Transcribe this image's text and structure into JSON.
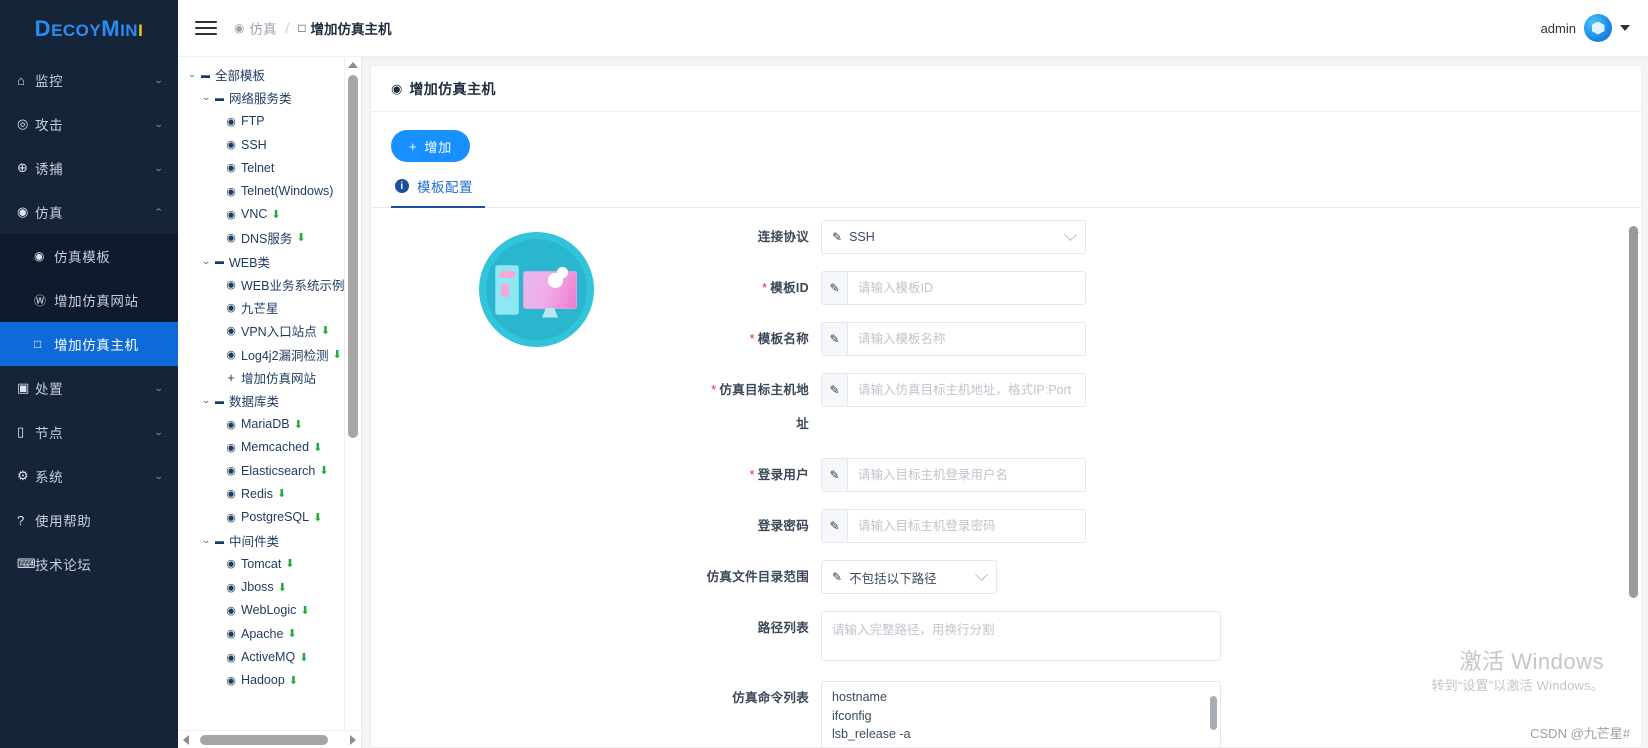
{
  "brand": {
    "name_part1": "D",
    "name_part2": "ECOY",
    "name_part3": "M",
    "name_part4": "IN",
    "name_dot": "I",
    "full": "DecoyMini"
  },
  "sidebar": {
    "items": [
      {
        "icon": "home-icon",
        "glyph": "⌂",
        "label": "监控",
        "arrow": "⌄",
        "expanded": false,
        "active": false
      },
      {
        "icon": "target-icon",
        "glyph": "◎",
        "label": "攻击",
        "arrow": "⌄",
        "expanded": false,
        "active": false
      },
      {
        "icon": "capture-icon",
        "glyph": "⊕",
        "label": "诱捕",
        "arrow": "⌄",
        "expanded": false,
        "active": false
      },
      {
        "icon": "simulation-icon",
        "glyph": "◉",
        "label": "仿真",
        "arrow": "⌃",
        "expanded": true,
        "active": false
      },
      {
        "icon": "disposal-icon",
        "glyph": "▣",
        "label": "处置",
        "arrow": "⌄",
        "expanded": false,
        "active": false
      },
      {
        "icon": "node-icon",
        "glyph": "☐",
        "label": "节点",
        "arrow": "⌄",
        "expanded": false,
        "active": false
      },
      {
        "icon": "gear-icon",
        "glyph": "⚙",
        "label": "系统",
        "arrow": "⌄",
        "expanded": false,
        "active": false
      },
      {
        "icon": "help-icon",
        "glyph": "?",
        "label": "使用帮助",
        "arrow": "",
        "expanded": false,
        "active": false
      },
      {
        "icon": "forum-icon",
        "glyph": "⌨",
        "label": "技术论坛",
        "arrow": "",
        "expanded": false,
        "active": false
      }
    ],
    "sub_items": [
      {
        "icon": "simulation-template-icon",
        "glyph": "◉",
        "label": "仿真模板",
        "active": false
      },
      {
        "icon": "add-simulation-site-icon",
        "glyph": "Ⓦ",
        "label": "增加仿真网站",
        "active": false
      },
      {
        "icon": "add-simulation-host-icon",
        "glyph": "□",
        "label": "增加仿真主机",
        "active": true
      }
    ]
  },
  "topbar": {
    "menu_icon": "hamburger-icon",
    "breadcrumb": [
      {
        "icon": "simulation-icon",
        "glyph": "◉",
        "label": "仿真",
        "current": false
      },
      {
        "icon": "host-icon",
        "glyph": "□",
        "label": "增加仿真主机",
        "current": true
      }
    ],
    "separator": "/",
    "user": "admin",
    "avatar_icon": "user-avatar-icon",
    "caret_icon": "chevron-down-icon"
  },
  "tree": {
    "nodes": [
      {
        "level": 1,
        "type": "folder",
        "caret": "⌄",
        "label": "全部模板",
        "download": false
      },
      {
        "level": 2,
        "type": "folder",
        "caret": "⌄",
        "label": "网络服务类",
        "download": false
      },
      {
        "level": 3,
        "type": "item",
        "label": "FTP",
        "download": false
      },
      {
        "level": 3,
        "type": "item",
        "label": "SSH",
        "download": false
      },
      {
        "level": 3,
        "type": "item",
        "label": "Telnet",
        "download": false
      },
      {
        "level": 3,
        "type": "item",
        "label": "Telnet(Windows)",
        "download": false
      },
      {
        "level": 3,
        "type": "item",
        "label": "VNC",
        "download": true
      },
      {
        "level": 3,
        "type": "item",
        "label": "DNS服务",
        "download": true
      },
      {
        "level": 2,
        "type": "folder",
        "caret": "⌄",
        "label": "WEB类",
        "download": false
      },
      {
        "level": 3,
        "type": "item",
        "label": "WEB业务系统示例",
        "download": false
      },
      {
        "level": 3,
        "type": "item",
        "label": "九芒星",
        "download": false
      },
      {
        "level": 3,
        "type": "item",
        "label": "VPN入口站点",
        "download": true
      },
      {
        "level": 3,
        "type": "item",
        "label": "Log4j2漏洞检测",
        "download": true
      },
      {
        "level": 3,
        "type": "add",
        "label": "增加仿真网站",
        "download": false
      },
      {
        "level": 2,
        "type": "folder",
        "caret": "⌄",
        "label": "数据库类",
        "download": false
      },
      {
        "level": 3,
        "type": "item",
        "label": "MariaDB",
        "download": true
      },
      {
        "level": 3,
        "type": "item",
        "label": "Memcached",
        "download": true
      },
      {
        "level": 3,
        "type": "item",
        "label": "Elasticsearch",
        "download": true
      },
      {
        "level": 3,
        "type": "item",
        "label": "Redis",
        "download": true
      },
      {
        "level": 3,
        "type": "item",
        "label": "PostgreSQL",
        "download": true
      },
      {
        "level": 2,
        "type": "folder",
        "caret": "⌄",
        "label": "中间件类",
        "download": false
      },
      {
        "level": 3,
        "type": "item",
        "label": "Tomcat",
        "download": true
      },
      {
        "level": 3,
        "type": "item",
        "label": "Jboss",
        "download": true
      },
      {
        "level": 3,
        "type": "item",
        "label": "WebLogic",
        "download": true
      },
      {
        "level": 3,
        "type": "item",
        "label": "Apache",
        "download": true
      },
      {
        "level": 3,
        "type": "item",
        "label": "ActiveMQ",
        "download": true
      },
      {
        "level": 3,
        "type": "item",
        "label": "Hadoop",
        "download": true
      }
    ],
    "download_glyph": "⬇"
  },
  "card": {
    "icon": "simulation-icon",
    "icon_glyph": "◉",
    "title": "增加仿真主机",
    "add_button": {
      "plus": "+",
      "label": "增加"
    },
    "tabs": [
      {
        "badge": "i",
        "label": "模板配置",
        "active": true
      }
    ]
  },
  "illustration": {
    "name": "computer-settings-illustration"
  },
  "form": {
    "fields": [
      {
        "name": "connection-protocol",
        "label": "连接协议",
        "required": false,
        "control": "select",
        "value": "SSH",
        "prefix_icon": "edit-icon"
      },
      {
        "name": "template-id",
        "label": "模板ID",
        "required": true,
        "control": "input",
        "value": "",
        "placeholder": "请输入模板ID",
        "prefix_icon": "edit-icon"
      },
      {
        "name": "template-name",
        "label": "模板名称",
        "required": true,
        "control": "input",
        "value": "",
        "placeholder": "请输入模板名称",
        "prefix_icon": "edit-icon"
      },
      {
        "name": "target-host-address",
        "label": "仿真目标主机地址",
        "required": true,
        "control": "input",
        "value": "",
        "placeholder": "请输入仿真目标主机地址，格式IP:Port",
        "prefix_icon": "edit-icon"
      },
      {
        "name": "login-user",
        "label": "登录用户",
        "required": true,
        "control": "input",
        "value": "",
        "placeholder": "请输入目标主机登录用户名",
        "prefix_icon": "edit-icon"
      },
      {
        "name": "login-password",
        "label": "登录密码",
        "required": false,
        "control": "input",
        "value": "",
        "placeholder": "请输入目标主机登录密码",
        "prefix_icon": "edit-icon"
      },
      {
        "name": "file-directory-scope",
        "label": "仿真文件目录范围",
        "required": false,
        "control": "select-narrow",
        "value": "不包括以下路径",
        "prefix_icon": "edit-icon"
      },
      {
        "name": "path-list",
        "label": "路径列表",
        "required": false,
        "control": "textarea",
        "value": "",
        "placeholder": "请输入完整路径，用换行分割"
      },
      {
        "name": "command-list",
        "label": "仿真命令列表",
        "required": false,
        "control": "commands",
        "commands": [
          "hostname",
          "ifconfig",
          "lsb_release -a"
        ]
      }
    ]
  },
  "watermark": {
    "windows_line1": "激活 Windows",
    "windows_line2": "转到“设置”以激活 Windows。",
    "csdn": "CSDN @九芒星#"
  }
}
